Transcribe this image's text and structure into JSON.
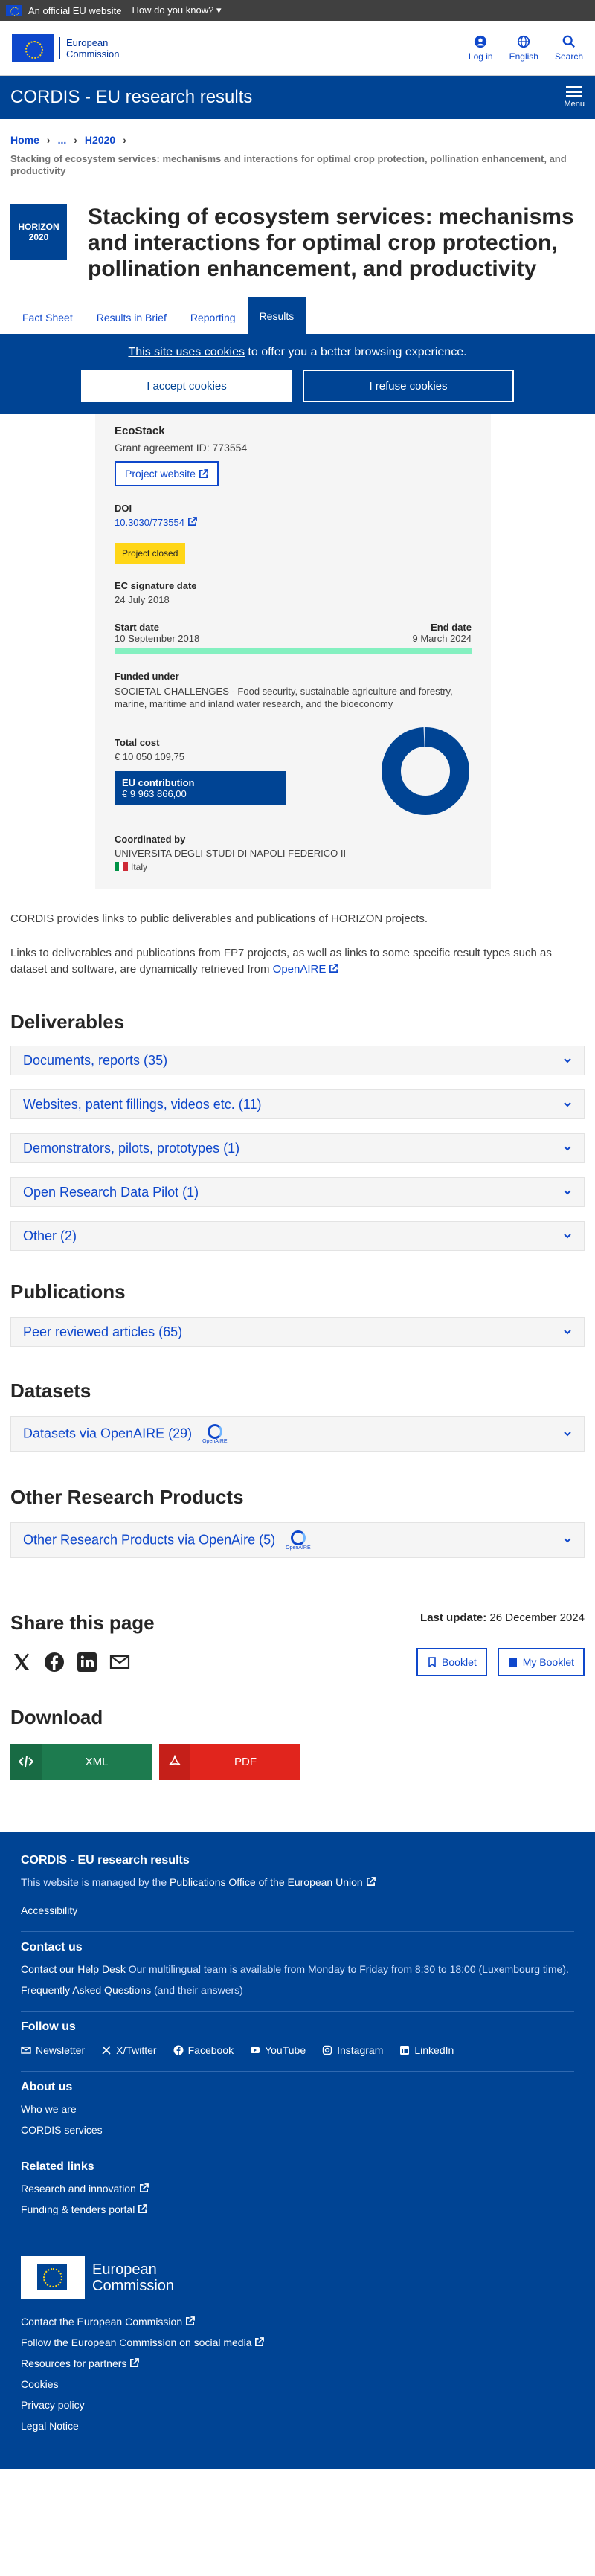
{
  "topbar": {
    "official": "An official EU website",
    "how": "How do you know?"
  },
  "header": {
    "logo_line1": "European",
    "logo_line2": "Commission",
    "login": "Log in",
    "language": "English",
    "search": "Search"
  },
  "banner": {
    "title": "CORDIS - EU research results",
    "menu": "Menu"
  },
  "breadcrumb": {
    "home": "Home",
    "ellipsis": "...",
    "h2020": "H2020"
  },
  "subtitle": "Stacking of ecosystem services: mechanisms and interactions for optimal crop protection, pollination enhancement, and productivity",
  "programme_badge": {
    "line1": "HORIZON",
    "line2": "2020"
  },
  "title": "Stacking of ecosystem services: mechanisms and interactions for optimal crop protection, pollination enhancement, and productivity",
  "tabs": [
    "Fact Sheet",
    "Results in Brief",
    "Reporting",
    "Results"
  ],
  "cookie": {
    "link": "This site uses cookies",
    "message": " to offer you a better browsing experience.",
    "accept": "I accept cookies",
    "refuse": "I refuse cookies"
  },
  "project": {
    "acronym": "EcoStack",
    "grant": "Grant agreement ID: 773554",
    "website": "Project website",
    "doi_label": "DOI",
    "doi": "10.3030/773554",
    "status": "Project closed",
    "signature_label": "EC signature date",
    "signature_date": "24 July 2018",
    "start_label": "Start date",
    "start": "10 September 2018",
    "end_label": "End date",
    "end": "9 March 2024",
    "funded_label": "Funded under",
    "funded": "SOCIETAL CHALLENGES - Food security, sustainable agriculture and forestry, marine, maritime and inland water research, and the bioeconomy",
    "cost_label": "Total cost",
    "cost": "€ 10 050 109,75",
    "contrib_label": "EU contribution",
    "contrib": "€ 9 963 866,00",
    "contrib_fraction": 0.9914,
    "coord_label": "Coordinated by",
    "coordinator": "UNIVERSITA DEGLI STUDI DI NAPOLI FEDERICO II",
    "country": "Italy"
  },
  "intro": {
    "p1": "CORDIS provides links to public deliverables and publications of HORIZON projects.",
    "p2": "Links to deliverables and publications from FP7 projects, as well as links to some specific result types such as dataset and software, are dynamically retrieved from ",
    "p2_link": "OpenAIRE"
  },
  "deliverables": {
    "heading": "Deliverables",
    "items": [
      "Documents, reports (35)",
      "Websites, patent fillings, videos etc. (11)",
      "Demonstrators, pilots, prototypes (1)",
      "Open Research Data Pilot (1)",
      "Other (2)"
    ]
  },
  "publications": {
    "heading": "Publications",
    "items": [
      "Peer reviewed articles (65)"
    ]
  },
  "datasets": {
    "heading": "Datasets",
    "items": [
      "Datasets via OpenAIRE (29)"
    ]
  },
  "other": {
    "heading": "Other Research Products",
    "items": [
      "Other Research Products via OpenAire (5)"
    ]
  },
  "openaire_logo_text": "OpenAIRE",
  "share": {
    "heading": "Share this page",
    "last_update_label": "Last update:",
    "last_update": "26 December 2024",
    "booklet": "Booklet",
    "my_booklet": "My Booklet",
    "icons": [
      "x-icon",
      "facebook-icon",
      "linkedin-icon",
      "email-icon"
    ]
  },
  "download": {
    "heading": "Download",
    "xml": "XML",
    "pdf": "PDF"
  },
  "footer": {
    "title": "CORDIS - EU research results",
    "managed_prefix": "This website is managed by the ",
    "managed_link": "Publications Office of the European Union",
    "accessibility": "Accessibility",
    "contact_heading": "Contact us",
    "help_desk": "Contact our Help Desk",
    "help_desk_text": "Our multilingual team is available from Monday to Friday from 8:30 to 18:00 (Luxembourg time).",
    "faq": "Frequently Asked Questions",
    "faq_suffix": "(and their answers)",
    "follow_heading": "Follow us",
    "follow": [
      "Newsletter",
      "X/Twitter",
      "Facebook",
      "YouTube",
      "Instagram",
      "LinkedIn"
    ],
    "about_heading": "About us",
    "who": "Who we are",
    "services": "CORDIS services",
    "related_heading": "Related links",
    "research": "Research and innovation",
    "funding": "Funding & tenders portal",
    "logo_line1": "European",
    "logo_line2": "Commission",
    "links": [
      "Contact the European Commission",
      "Follow the European Commission on social media",
      "Resources for partners",
      "Cookies",
      "Privacy policy",
      "Legal Notice"
    ]
  },
  "colors": {
    "primary": "#004494",
    "link": "#0e47cb",
    "status": "#ffd617",
    "timeline": "#84f0c0",
    "xml": "#1d7b4f",
    "pdf": "#e1251d"
  }
}
